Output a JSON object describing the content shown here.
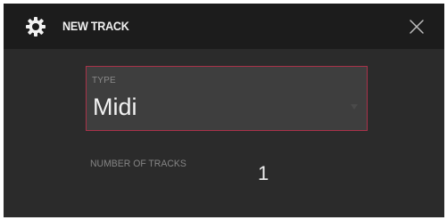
{
  "dialog": {
    "title": "NEW TRACK",
    "icon": "gear-icon",
    "close_icon": "close-icon"
  },
  "type_field": {
    "label": "TYPE",
    "value": "Midi",
    "arrow_icon": "chevron-down-icon"
  },
  "tracks_field": {
    "label": "NUMBER OF TRACKS",
    "value": "1"
  },
  "colors": {
    "header_bg": "#1c1c1c",
    "body_bg": "#2b2b2b",
    "field_bg": "#3e3e3e",
    "accent_border": "#a9324a",
    "text": "#f0f0f0",
    "muted_text": "#858585"
  }
}
